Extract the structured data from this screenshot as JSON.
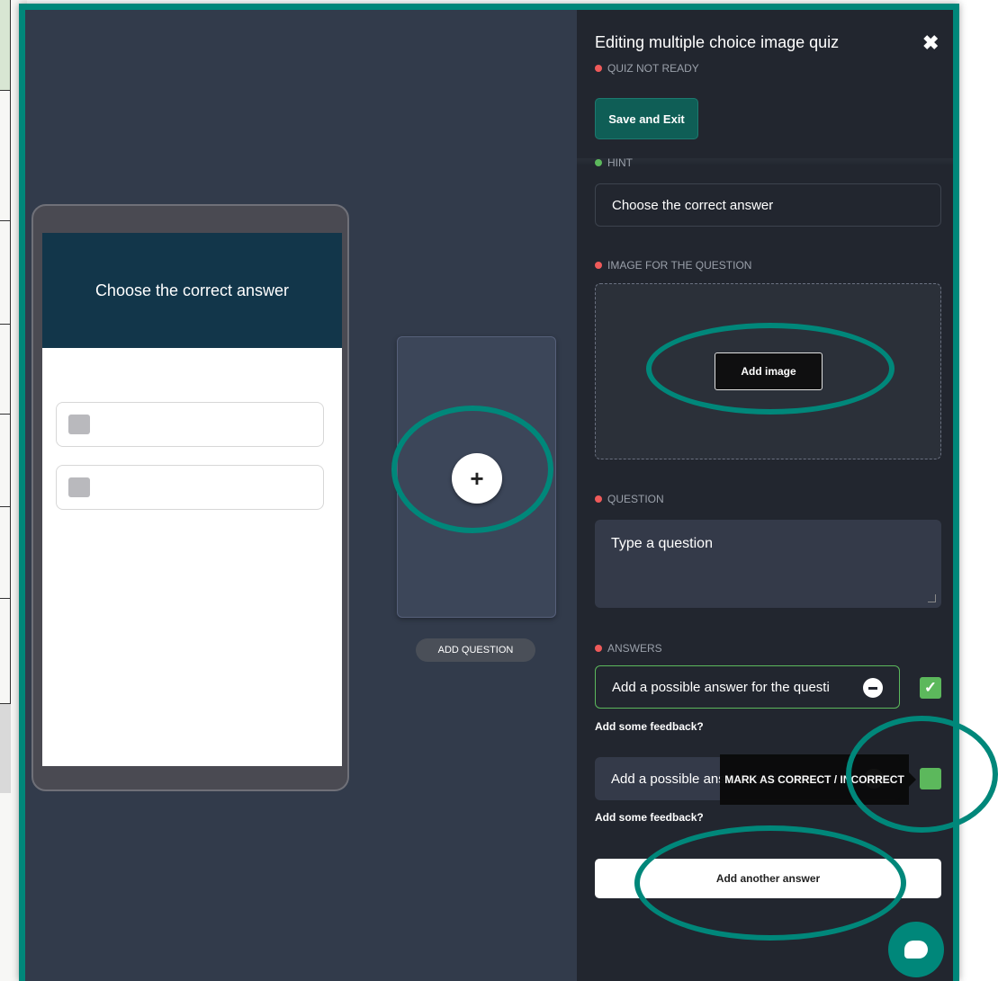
{
  "editor": {
    "title": "Editing multiple choice image quiz",
    "status": "QUIZ NOT READY",
    "save_label": "Save and Exit",
    "close_icon": "close-icon"
  },
  "preview": {
    "header_text": "Choose the correct answer",
    "add_question_label": "ADD QUESTION"
  },
  "form": {
    "hint_label": "HINT",
    "hint_value": "Choose the correct answer",
    "image_label": "IMAGE FOR THE QUESTION",
    "add_image_label": "Add image",
    "question_label": "QUESTION",
    "question_placeholder": "Type a question",
    "answers_label": "ANSWERS",
    "answers": [
      {
        "placeholder": "Add a possible answer for the questi",
        "correct": true
      },
      {
        "placeholder": "Add a possible answer for the quest",
        "correct": false
      }
    ],
    "feedback_link": "Add some feedback?",
    "tooltip": "MARK AS CORRECT / INCORRECT",
    "add_answer_label": "Add another answer"
  },
  "colors": {
    "accent": "#00877a",
    "status_red": "#ef5a5a",
    "status_green": "#5cb85c"
  }
}
